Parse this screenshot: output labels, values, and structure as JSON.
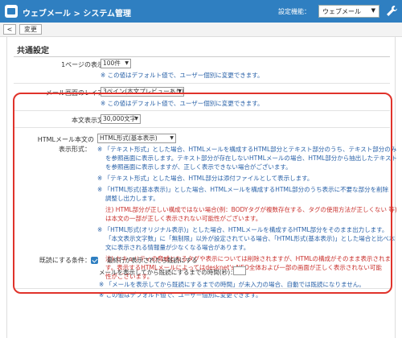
{
  "header": {
    "title": "ウェブメール > システム管理",
    "func_label": "設定機能：",
    "func_value": "ウェブメール"
  },
  "toolbar": {
    "back_label": "<",
    "save_label": "変更"
  },
  "section": {
    "title": "共通設定"
  },
  "rows": {
    "page_count": {
      "label": "1ページの表示件数：",
      "value": "100件",
      "note": "※ この値はデフォルト値で、ユーザー個別に変更できます。"
    },
    "layout": {
      "label": "メール画面のレイアウト：",
      "value": "3ペイン(本文プレビューあり)",
      "note": "※ この値はデフォルト値で、ユーザー個別に変更できます。"
    },
    "char_count": {
      "label": "本文表示文字数：",
      "value": "30,000文字"
    },
    "html_format": {
      "label1": "HTMLメール本文の",
      "label2": "表示形式：",
      "value": "HTML形式(基本表示)",
      "lines": [
        "※ 「テキスト形式」とした場合、HTMLメールを構成するHTML部分とテキスト部分のうち、テキスト部分のみ",
        "を参照画面に表示します。テキスト部分が存在しないHTMLメールの場合、HTML部分から抽出したテキスト",
        "を参照画面に表示しますが、正しく表示できない場合がございます。",
        "※ 「テキスト形式」とした場合、HTML部分は添付ファイルとして表示します。",
        "※ 「HTML形式(基本表示)」とした場合、HTMLメールを構成するHTML部分のうち表示に不要な部分を削除・",
        "調整し出力します。",
        "注) HTML部分が正しい構成ではない場合(例：BODYタグが複数存在する、タグの使用方法が正しくない 等)",
        "は本文の一部が正しく表示されない可能性がございます。",
        "※ 「HTML形式(オリジナル表示)」とした場合、HTMLメールを構成するHTML部分をそのまま出力します。",
        "「本文表示文字数」に「無制限」以外が設定されている場合、「HTML形式(基本表示)」とした場合と比べ本",
        "文に表示される情報量が少なくなる場合があります。",
        "注) セキュリティの脅威となるタグや表示については削除されますが、HTMLの構成がそのまま表示されま",
        "す。表示するHTMLメールによってはdesknet's NEO全体および一部の画面が正しく表示されない可能",
        "性がございます。"
      ]
    },
    "read_condition": {
      "label": "既読にする条件：",
      "checkbox_label": "最終行が表示されたら既読にする",
      "time_label": "メールを表示してから既読にするまでの時間(秒)：",
      "note1": "※ 「メールを表示してから既読にするまでの時間」が未入力の場合、自動では既読になりません。",
      "note2": "※ この値はデフォルト値で、ユーザー個別に変更できます。"
    }
  },
  "colors": {
    "header_bg": "#2f7fc1",
    "note_blue": "#2a62a8",
    "note_red": "#c9302c",
    "highlight": "#e0332b"
  }
}
